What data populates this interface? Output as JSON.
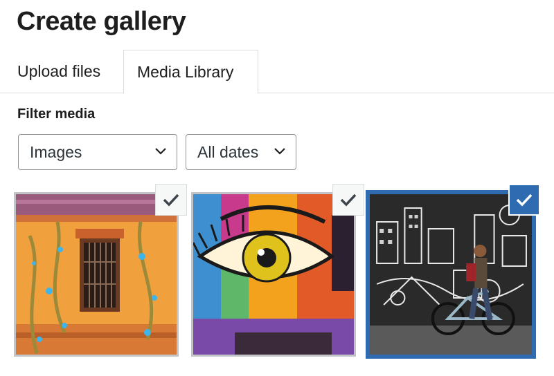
{
  "page": {
    "title": "Create gallery"
  },
  "tabs": [
    {
      "label": "Upload files",
      "active": false
    },
    {
      "label": "Media Library",
      "active": true
    }
  ],
  "filter": {
    "label": "Filter media",
    "type_select": "Images",
    "date_select": "All dates"
  },
  "media": [
    {
      "subject": "orange colonial building facade with vine mural",
      "selected": true,
      "focused": false
    },
    {
      "subject": "colorful street art of a large eye",
      "selected": true,
      "focused": false
    },
    {
      "subject": "man walking a bicycle past black-and-white mural",
      "selected": true,
      "focused": true
    }
  ],
  "colors": {
    "accent": "#2f6bb0",
    "check_inactive": "#f6f7f7",
    "check_mark_inactive": "#3c434a"
  },
  "icons": {
    "chevron": "chevron-down-icon",
    "check": "checkmark-icon"
  }
}
